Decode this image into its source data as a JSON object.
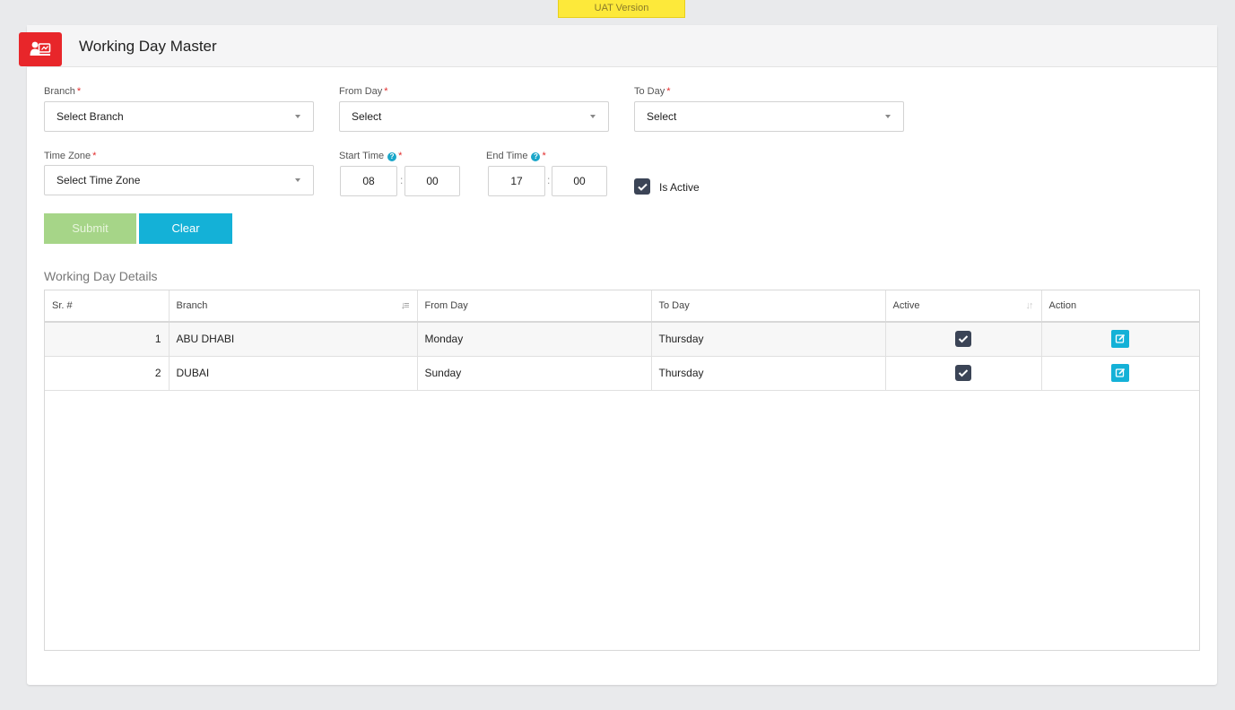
{
  "banner": {
    "label": "UAT Version"
  },
  "header": {
    "title": "Working Day Master",
    "logo_icon": "user-monitor-icon"
  },
  "form": {
    "branch": {
      "label": "Branch",
      "value": "Select Branch"
    },
    "from_day": {
      "label": "From Day",
      "value": "Select"
    },
    "to_day": {
      "label": "To Day",
      "value": "Select"
    },
    "time_zone": {
      "label": "Time Zone",
      "value": "Select Time Zone"
    },
    "start_time": {
      "label": "Start Time",
      "hours": "08",
      "minutes": "00"
    },
    "end_time": {
      "label": "End Time",
      "hours": "17",
      "minutes": "00"
    },
    "required_mark": "*",
    "help_glyph": "?",
    "time_separator": ":",
    "is_active": {
      "label": "Is Active",
      "checked": true
    },
    "submit_label": "Submit",
    "clear_label": "Clear"
  },
  "details": {
    "title": "Working Day Details",
    "columns": [
      "Sr. #",
      "Branch",
      "From Day",
      "To Day",
      "Active",
      "Action"
    ],
    "rows": [
      {
        "sr": "1",
        "branch": "ABU DHABI",
        "from_day": "Monday",
        "to_day": "Thursday",
        "active": true
      },
      {
        "sr": "2",
        "branch": "DUBAI",
        "from_day": "Sunday",
        "to_day": "Thursday",
        "active": true
      }
    ]
  },
  "colors": {
    "brand_red": "#e8262a",
    "accent_cyan": "#14b1d7",
    "submit_green": "#a6d588",
    "checkbox_dark": "#3b4456",
    "uat_yellow": "#fde93a"
  }
}
